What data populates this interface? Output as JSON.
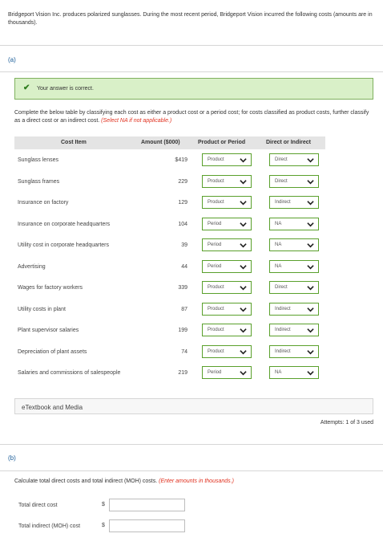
{
  "intro": "Bridgeport Vision Inc. produces polarized sunglasses. During the most recent period, Bridgeport Vision incurred the following costs (amounts are in thousands).",
  "part_a": {
    "label": "(a)",
    "feedback": "Your answer is correct.",
    "instructions": "Complete the below table by classifying each cost as either a product cost or a period cost; for costs classified as product costs, further classify as a direct cost or an indirect cost.",
    "instructions_note": "(Select NA if not applicable.)",
    "table": {
      "headers": {
        "item": "Cost Item",
        "amount": "Amount ($000)",
        "product_period": "Product or Period",
        "direct_indirect": "Direct or Indirect"
      },
      "rows": [
        {
          "item": "Sunglass lenses",
          "amount": "$419",
          "product_period": "Product",
          "direct_indirect": "Direct"
        },
        {
          "item": "Sunglass frames",
          "amount": "229",
          "product_period": "Product",
          "direct_indirect": "Direct"
        },
        {
          "item": "Insurance on factory",
          "amount": "129",
          "product_period": "Product",
          "direct_indirect": "Indirect"
        },
        {
          "item": "Insurance on corporate headquarters",
          "amount": "104",
          "product_period": "Period",
          "direct_indirect": "NA"
        },
        {
          "item": "Utility cost in corporate headquarters",
          "amount": "39",
          "product_period": "Period",
          "direct_indirect": "NA"
        },
        {
          "item": "Advertising",
          "amount": "44",
          "product_period": "Period",
          "direct_indirect": "NA"
        },
        {
          "item": "Wages for factory workers",
          "amount": "339",
          "product_period": "Product",
          "direct_indirect": "Direct"
        },
        {
          "item": "Utility costs in plant",
          "amount": "87",
          "product_period": "Product",
          "direct_indirect": "Indirect"
        },
        {
          "item": "Plant supervisor salaries",
          "amount": "199",
          "product_period": "Product",
          "direct_indirect": "Indirect"
        },
        {
          "item": "Depreciation of plant assets",
          "amount": "74",
          "product_period": "Product",
          "direct_indirect": "Indirect"
        },
        {
          "item": "Salaries and commissions of salespeople",
          "amount": "219",
          "product_period": "Period",
          "direct_indirect": "NA"
        }
      ]
    },
    "etextbook": "eTextbook and Media",
    "attempts": "Attempts: 1 of 3 used"
  },
  "part_b": {
    "label": "(b)",
    "instructions": "Calculate total direct costs and total indirect (MOH) costs.",
    "instructions_note": "(Enter amounts in thousands.)",
    "fields": [
      {
        "label": "Total direct cost",
        "currency": "$",
        "value": ""
      },
      {
        "label": "Total indirect (MOH) cost",
        "currency": "$",
        "value": ""
      }
    ]
  },
  "colors": {
    "accent_blue": "#1a5d99",
    "success_green": "#5aa02c",
    "success_bg": "#d9f0c8",
    "note_red": "#e0301e"
  }
}
